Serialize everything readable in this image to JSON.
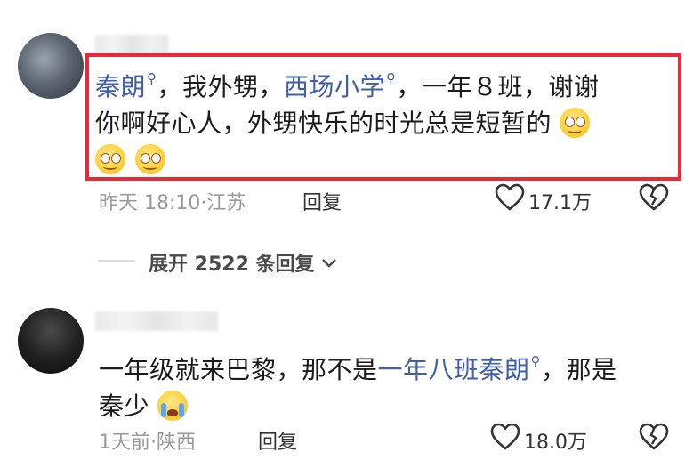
{
  "comments": [
    {
      "text": {
        "link1": "秦朗",
        "part1": "，我外甥，",
        "link2": "西场小学",
        "part2": "，一年８班，谢谢",
        "line2": "你啊好心人，外甥快乐的时光总是短暂的"
      },
      "time": "昨天 18:10",
      "location": "江苏",
      "reply_label": "回复",
      "likes": "17.1万",
      "emojis": [
        "smile-emoji",
        "smile-emoji",
        "smile-emoji"
      ]
    },
    {
      "text": {
        "part1": "一年级就来巴黎，那不是",
        "link1": "一年八班秦朗",
        "part2": "，那是",
        "line2": "秦少"
      },
      "time": "1天前",
      "location": "陕西",
      "reply_label": "回复",
      "likes": "18.0万",
      "emojis": [
        "crying-emoji"
      ]
    }
  ],
  "expand_replies": "展开 2522 条回复",
  "colors": {
    "link": "#3f5fa8",
    "highlight_border": "#e8293a",
    "meta": "#9a9a9a"
  }
}
